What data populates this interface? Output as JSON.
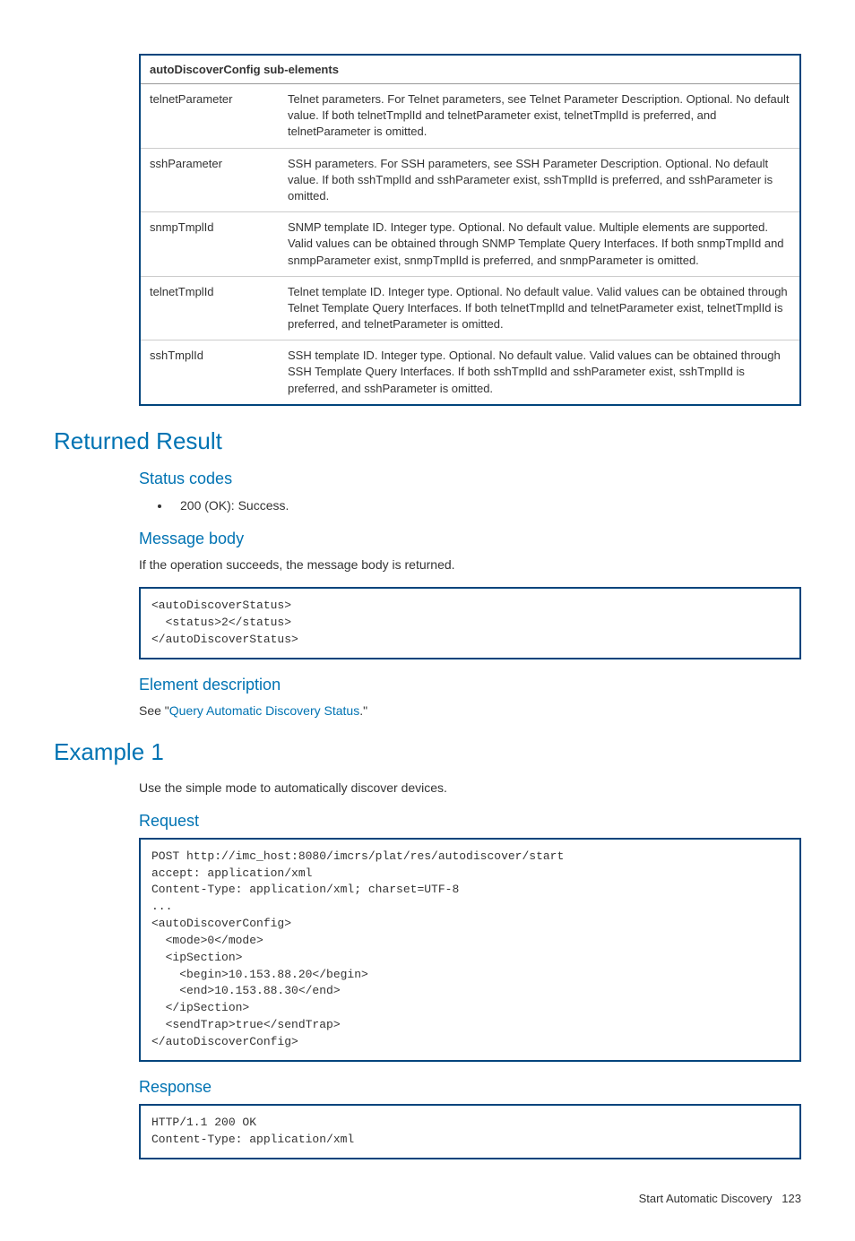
{
  "table": {
    "header": "autoDiscoverConfig sub-elements",
    "rows": [
      {
        "name": "telnetParameter",
        "desc": "Telnet parameters. For Telnet parameters, see Telnet Parameter Description. Optional. No default value. If both telnetTmplId and telnetParameter exist, telnetTmplId is preferred, and telnetParameter is omitted."
      },
      {
        "name": "sshParameter",
        "desc": "SSH parameters. For SSH parameters, see SSH Parameter Description. Optional. No default value. If both sshTmplId and sshParameter exist, sshTmplId is preferred, and sshParameter is omitted."
      },
      {
        "name": "snmpTmplId",
        "desc": "SNMP template ID. Integer type. Optional. No default value. Multiple elements are supported. Valid values can be obtained through SNMP Template Query Interfaces. If both snmpTmplId and snmpParameter exist, snmpTmplId is preferred, and snmpParameter is omitted."
      },
      {
        "name": "telnetTmplId",
        "desc": "Telnet template ID. Integer type. Optional. No default value. Valid values can be obtained through Telnet Template Query Interfaces. If both telnetTmplId and telnetParameter exist, telnetTmplId is preferred, and telnetParameter is omitted."
      },
      {
        "name": "sshTmplId",
        "desc": "SSH template ID. Integer type. Optional. No default value. Valid values can be obtained through SSH Template Query Interfaces. If both sshTmplId and sshParameter exist, sshTmplId is preferred, and sshParameter is omitted."
      }
    ]
  },
  "headings": {
    "returned_result": "Returned Result",
    "status_codes": "Status codes",
    "message_body": "Message body",
    "element_description": "Element description",
    "example1": "Example 1",
    "request": "Request",
    "response": "Response"
  },
  "text": {
    "status_item": "200 (OK): Success.",
    "message_body_p": "If the operation succeeds, the message body is returned.",
    "see_prefix": "See \"",
    "see_link": "Query Automatic Discovery Status",
    "see_suffix": ".\"",
    "example1_p": "Use the simple mode to automatically discover devices."
  },
  "code": {
    "message_body": "<autoDiscoverStatus>\n  <status>2</status>\n</autoDiscoverStatus>",
    "request": "POST http://imc_host:8080/imcrs/plat/res/autodiscover/start\naccept: application/xml\nContent-Type: application/xml; charset=UTF-8\n...\n<autoDiscoverConfig>\n  <mode>0</mode>\n  <ipSection>\n    <begin>10.153.88.20</begin>\n    <end>10.153.88.30</end>\n  </ipSection>\n  <sendTrap>true</sendTrap>\n</autoDiscoverConfig>",
    "response": "HTTP/1.1 200 OK\nContent-Type: application/xml"
  },
  "footer": {
    "title": "Start Automatic Discovery",
    "page": "123"
  }
}
